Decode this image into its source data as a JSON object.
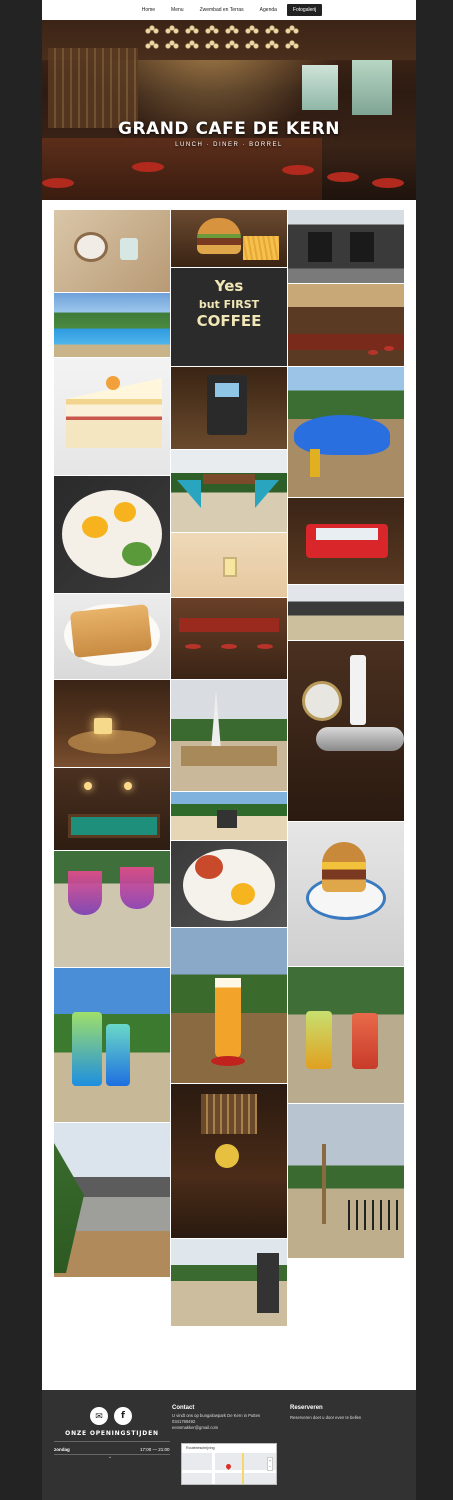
{
  "nav": {
    "items": [
      {
        "label": "Home"
      },
      {
        "label": "Menu"
      },
      {
        "label": "Zwembad en Terras"
      },
      {
        "label": "Agenda"
      },
      {
        "label": "Fotogalerij"
      }
    ],
    "active": "Fotogalerij"
  },
  "hero": {
    "title": "GRAND CAFE DE KERN",
    "subtitle": "LUNCH · DINER · BORREL"
  },
  "gallery": {
    "photos": [
      "latte-on-tray",
      "burger-and-fries",
      "cafe-building-exterior",
      "swimming-pool",
      "yes-but-first-coffee-sign",
      "bar-interior",
      "cream-cake",
      "coffee-machine",
      "playground-whale",
      "eggs-bacon-plate",
      "playground-slides",
      "ice-cream-freezer",
      "apple-pie",
      "cafe-interior-lights",
      "terrace-tables",
      "candles-table",
      "bar-stools",
      "veltins-tap",
      "billiard-table",
      "terrace-umbrella",
      "beach-volleyball",
      "pink-cocktails",
      "breakfast-plate",
      "burger-plate",
      "blue-cocktails",
      "texels-beer",
      "mojito-cocktails",
      "terrace-lounge",
      "bar-night",
      "pool-terrace",
      "beach-field"
    ]
  },
  "footer": {
    "social": [
      {
        "icon": "mail-icon"
      },
      {
        "icon": "facebook-icon"
      }
    ],
    "hours_title": "ONZE OPENINGSTIJDEN",
    "hours": [
      {
        "day": "zondag",
        "time": "17:00 — 21:00"
      }
    ],
    "contact": {
      "heading": "Contact",
      "lines": [
        "U vindt ons op bungalowpark De Kern in Putten",
        "0341769492",
        "eensmakker@gmail.com"
      ]
    },
    "map": {
      "label": "Routebeschrijving"
    },
    "reserve": {
      "heading": "Reserveren",
      "text": "Reserveren doet u door even te bellen"
    }
  }
}
